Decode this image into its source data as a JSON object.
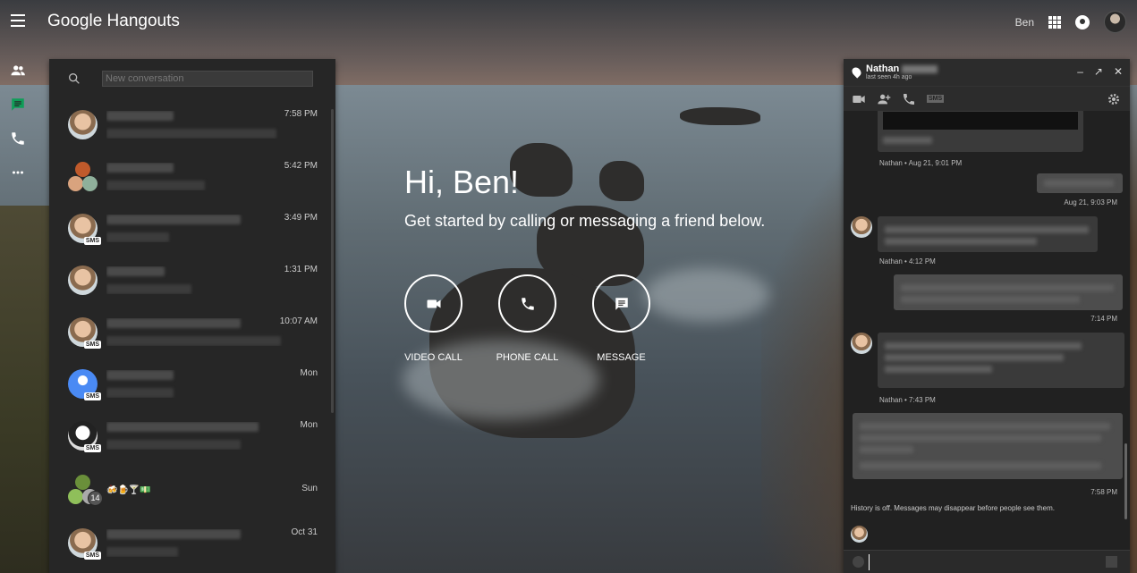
{
  "app": {
    "brand_title": "Google Hangouts",
    "current_user": "Ben"
  },
  "search": {
    "placeholder": "New conversation"
  },
  "conversations": [
    {
      "time": "7:58 PM",
      "avatar": "face",
      "badge": ""
    },
    {
      "time": "5:42 PM",
      "avatar": "group",
      "badge": ""
    },
    {
      "time": "3:49 PM",
      "avatar": "face",
      "badge": "SMS"
    },
    {
      "time": "1:31 PM",
      "avatar": "face",
      "badge": ""
    },
    {
      "time": "10:07 AM",
      "avatar": "face",
      "badge": "SMS"
    },
    {
      "time": "Mon",
      "avatar": "blue",
      "badge": "SMS"
    },
    {
      "time": "Mon",
      "avatar": "bw",
      "badge": "SMS"
    },
    {
      "time": "Sun",
      "avatar": "group",
      "badge": "14",
      "snippet_emoji": "🍻🍺🍸💵"
    },
    {
      "time": "Oct 31",
      "avatar": "face",
      "badge": "SMS"
    }
  ],
  "welcome": {
    "greeting": "Hi, Ben!",
    "subtitle": "Get started by calling or messaging a friend below."
  },
  "actions": {
    "video_call": "VIDEO CALL",
    "phone_call": "PHONE CALL",
    "message": "MESSAGE"
  },
  "chat": {
    "contact_first_name": "Nathan",
    "last_seen": "last seen 4h ago",
    "sms_label": "SMS",
    "meta": {
      "m1": "Nathan • Aug 21, 9:01 PM",
      "m2": "Aug 21, 9:03 PM",
      "m3": "Nathan • 4:12 PM",
      "m4": "7:14 PM",
      "m5": "Nathan • 7:43 PM",
      "m6": "7:58 PM"
    },
    "history_note": "History is off. Messages may disappear before people see them."
  },
  "colors": {
    "panel_bg": "#262626",
    "chat_bg": "#212121",
    "active_rail": "#0f9d58"
  }
}
